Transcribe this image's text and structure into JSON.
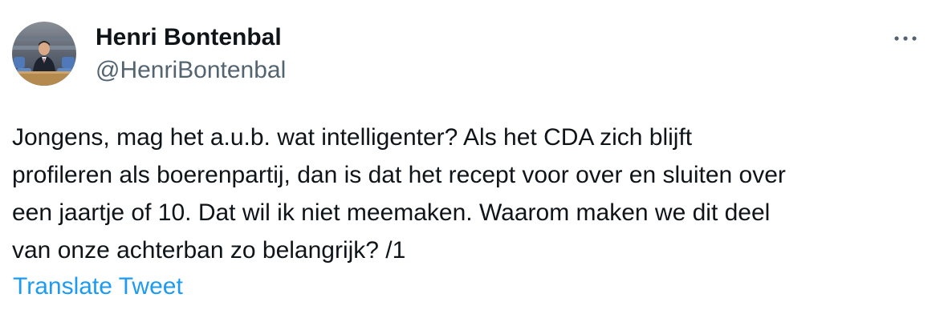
{
  "author": {
    "display_name": "Henri Bontenbal",
    "handle": "@HenriBontenbal"
  },
  "tweet": {
    "lines": [
      "Jongens, mag het a.u.b. wat intelligenter? Als het CDA zich blijft",
      "profileren als boerenpartij, dan is dat het recept voor over en sluiten over",
      "een jaartje of 10. Dat wil ik niet meemaken. Waarom maken we dit deel",
      "van onze achterban zo belangrijk? /1"
    ]
  },
  "actions": {
    "translate_label": "Translate Tweet",
    "more_icon": "more-horizontal-icon"
  },
  "colors": {
    "text": "#0f1419",
    "secondary": "#536471",
    "link": "#1d9bf0"
  }
}
